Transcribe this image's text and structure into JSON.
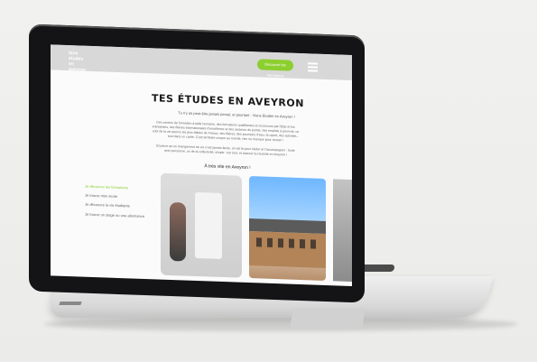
{
  "site": {
    "logo_lines": [
      "faire",
      "études",
      "en",
      "aveyron"
    ],
    "cta_label": "Découvrir les formations",
    "menu_icon": "hamburger-icon"
  },
  "hero": {
    "title": "TES ÉTUDES EN AVEYRON",
    "subtitle": "Tu n'y as peut-être jamais pensé, et pourtant : Viens Étudier en Aveyron !",
    "paragraph_1": "Des centres de formation à taille humaine, des formations qualifiantes et reconnues par l'État et les entreprises, des filières internationales d'excellence et des secteurs de pointe, des emplois à pourvoir, un coût de la vie permis les plus faibles de France, des filières, des poumons d'eau, du sport, des activités... tout dans un cadre. C'est territoire unique au monde, rien ne manque pour réussir !",
    "paragraph_2": "Et parce qu'un changement de vie n'est jamais facile, on est là pour t'aider et t'accompagner : toute avec personne, ou de la collectivité, simple : ton tout, et assurer ta réussite en Aveyron !",
    "paragraph_3": "À très vite en Aveyron !"
  },
  "sidebar": {
    "items": [
      {
        "label": "Je découvre les formations",
        "active": true
      },
      {
        "label": "Je trouve mon école",
        "active": false
      },
      {
        "label": "Je découvre la vie étudiante",
        "active": false
      },
      {
        "label": "Je trouve un stage ou une alternance",
        "active": false
      }
    ]
  },
  "colors": {
    "accent": "#8ccf2f",
    "lid": "#141416",
    "screen_bg": "#fbfbfb"
  }
}
